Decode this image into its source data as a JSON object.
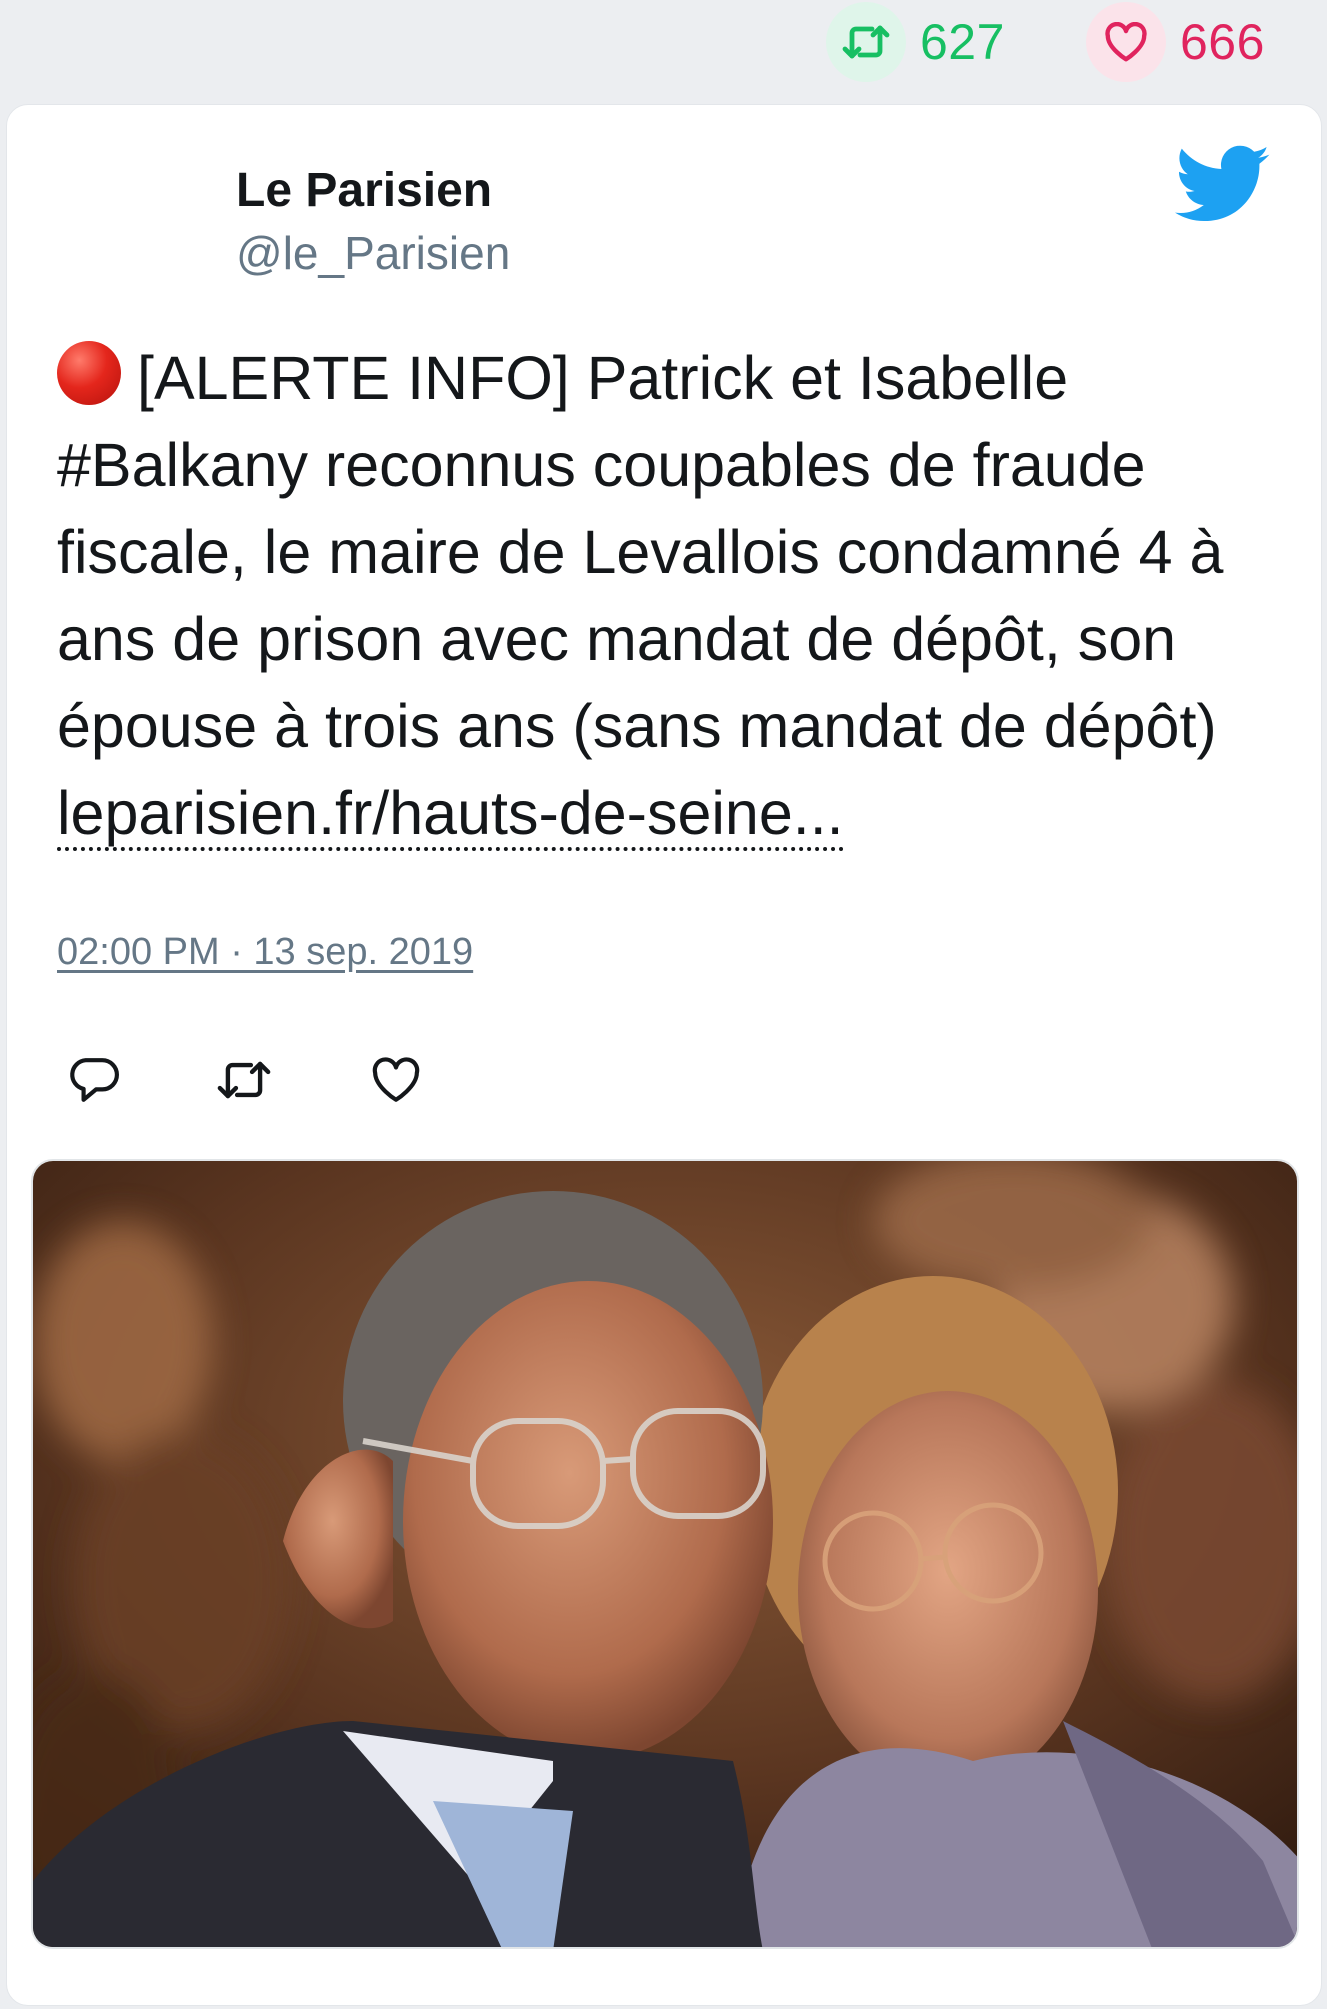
{
  "stats": {
    "retweet_count": "627",
    "like_count": "666",
    "retweet_icon": "retweet-icon",
    "like_icon": "heart-icon"
  },
  "tweet": {
    "author_name": "Le Parisien",
    "author_handle": "@le_Parisien",
    "text": "[ALERTE INFO] Patrick et Isabelle #Balkany reconnus coupables de fraude fiscale, le maire de Levallois condamné 4 à ans de prison avec mandat de dépôt, son épouse à trois ans (sans mandat de dépôt)",
    "link_text": "leparisien.fr/hauts-de-seine...",
    "timestamp": "02:00 PM · 13 sep. 2019",
    "leading_icon": "red-circle-icon",
    "brand_icon": "twitter-bird-icon",
    "actions": [
      "reply-icon",
      "retweet-icon",
      "like-icon"
    ]
  },
  "colors": {
    "background": "#eceef1",
    "retweet_green": "#17bf63",
    "like_red": "#e0245e",
    "twitter_blue": "#1da1f2",
    "text_primary": "#14171a",
    "text_secondary": "#657786"
  }
}
